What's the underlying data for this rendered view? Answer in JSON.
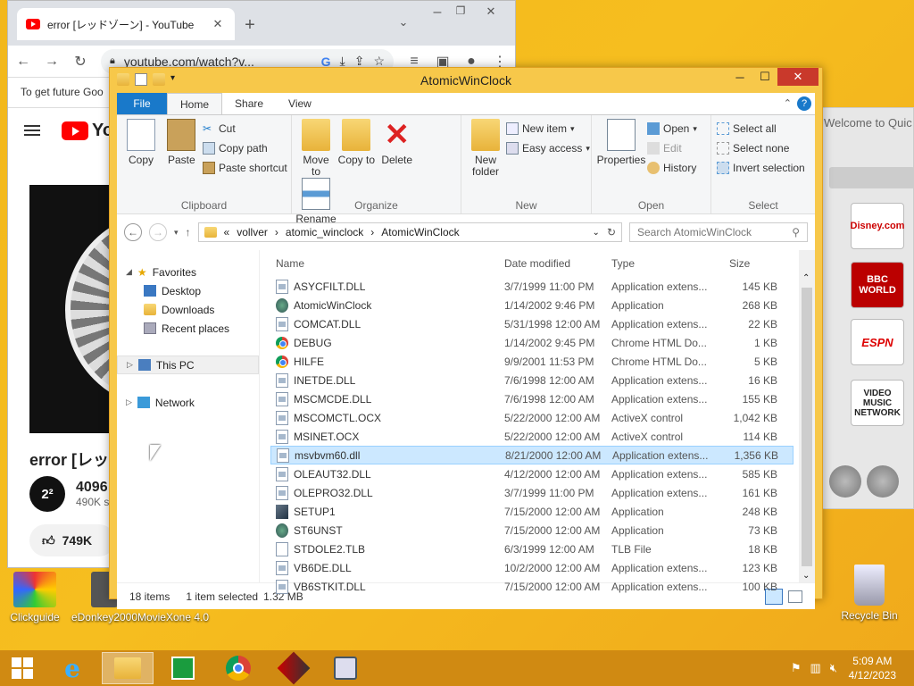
{
  "chrome": {
    "tab_title": "error [レッドゾーン] - YouTube",
    "url": "youtube.com/watch?v...",
    "signin_text": "To get future Goo",
    "yt_logo": "Yo",
    "video_title": "error [レッ",
    "channel_avatar": "2²",
    "channel_name": "4096",
    "channel_subs": "490K s",
    "likes": "749K"
  },
  "radio": {
    "header": "Welcome to Quic",
    "logos": [
      "Disney.com",
      "BBC WORLD",
      "ESPN",
      "VIDEO MUSIC NETWORK"
    ]
  },
  "desktop_icons": [
    {
      "label": "Clickguide"
    },
    {
      "label": "eDonkey2000"
    },
    {
      "label": "MovieXone 4.0"
    },
    {
      "label": "Recycle Bin"
    }
  ],
  "explorer": {
    "title": "AtomicWinClock",
    "tabs": {
      "file": "File",
      "home": "Home",
      "share": "Share",
      "view": "View"
    },
    "ribbon": {
      "copy": "Copy",
      "paste": "Paste",
      "cut": "Cut",
      "copy_path": "Copy path",
      "paste_shortcut": "Paste shortcut",
      "clipboard": "Clipboard",
      "move_to": "Move to",
      "copy_to": "Copy to",
      "delete": "Delete",
      "rename": "Rename",
      "organize": "Organize",
      "new_folder": "New folder",
      "new_item": "New item",
      "easy_access": "Easy access",
      "new": "New",
      "properties": "Properties",
      "open_btn": "Open",
      "edit": "Edit",
      "history": "History",
      "open": "Open",
      "select_all": "Select all",
      "select_none": "Select none",
      "invert_selection": "Invert selection",
      "select": "Select"
    },
    "breadcrumb": [
      "vollver",
      "atomic_winclock",
      "AtomicWinClock"
    ],
    "breadcrumb_prefix": "«",
    "search_placeholder": "Search AtomicWinClock",
    "nav": {
      "favorites": "Favorites",
      "desktop": "Desktop",
      "downloads": "Downloads",
      "recent": "Recent places",
      "this_pc": "This PC",
      "network": "Network"
    },
    "columns": {
      "name": "Name",
      "date": "Date modified",
      "type": "Type",
      "size": "Size"
    },
    "files": [
      {
        "name": "ASYCFILT.DLL",
        "date": "3/7/1999 11:00 PM",
        "type": "Application extens...",
        "size": "145 KB",
        "icon": "dll"
      },
      {
        "name": "AtomicWinClock",
        "date": "1/14/2002 9:46 PM",
        "type": "Application",
        "size": "268 KB",
        "icon": "app"
      },
      {
        "name": "COMCAT.DLL",
        "date": "5/31/1998 12:00 AM",
        "type": "Application extens...",
        "size": "22 KB",
        "icon": "dll"
      },
      {
        "name": "DEBUG",
        "date": "1/14/2002 9:45 PM",
        "type": "Chrome HTML Do...",
        "size": "1 KB",
        "icon": "chrome"
      },
      {
        "name": "HILFE",
        "date": "9/9/2001 11:53 PM",
        "type": "Chrome HTML Do...",
        "size": "5 KB",
        "icon": "chrome"
      },
      {
        "name": "INETDE.DLL",
        "date": "7/6/1998 12:00 AM",
        "type": "Application extens...",
        "size": "16 KB",
        "icon": "dll"
      },
      {
        "name": "MSCMCDE.DLL",
        "date": "7/6/1998 12:00 AM",
        "type": "Application extens...",
        "size": "155 KB",
        "icon": "dll"
      },
      {
        "name": "MSCOMCTL.OCX",
        "date": "5/22/2000 12:00 AM",
        "type": "ActiveX control",
        "size": "1,042 KB",
        "icon": "dll"
      },
      {
        "name": "MSINET.OCX",
        "date": "5/22/2000 12:00 AM",
        "type": "ActiveX control",
        "size": "114 KB",
        "icon": "dll"
      },
      {
        "name": "msvbvm60.dll",
        "date": "8/21/2000 12:00 AM",
        "type": "Application extens...",
        "size": "1,356 KB",
        "icon": "dll"
      },
      {
        "name": "OLEAUT32.DLL",
        "date": "4/12/2000 12:00 AM",
        "type": "Application extens...",
        "size": "585 KB",
        "icon": "dll"
      },
      {
        "name": "OLEPRO32.DLL",
        "date": "3/7/1999 11:00 PM",
        "type": "Application extens...",
        "size": "161 KB",
        "icon": "dll"
      },
      {
        "name": "SETUP1",
        "date": "7/15/2000 12:00 AM",
        "type": "Application",
        "size": "248 KB",
        "icon": "setup"
      },
      {
        "name": "ST6UNST",
        "date": "7/15/2000 12:00 AM",
        "type": "Application",
        "size": "73 KB",
        "icon": "app"
      },
      {
        "name": "STDOLE2.TLB",
        "date": "6/3/1999 12:00 AM",
        "type": "TLB File",
        "size": "18 KB",
        "icon": "file"
      },
      {
        "name": "VB6DE.DLL",
        "date": "10/2/2000 12:00 AM",
        "type": "Application extens...",
        "size": "123 KB",
        "icon": "dll"
      },
      {
        "name": "VB6STKIT.DLL",
        "date": "7/15/2000 12:00 AM",
        "type": "Application extens...",
        "size": "100 KB",
        "icon": "dll"
      }
    ],
    "selected_index": 9,
    "status_items": "18 items",
    "status_selected": "1 item selected",
    "status_size": "1.32 MB"
  },
  "taskbar": {
    "time": "5:09 AM",
    "date": "4/12/2023"
  },
  "colors": {
    "file_tab": "#1979ca",
    "selection": "#cce8ff",
    "taskbar": "#d08a12",
    "window_frame": "#f7c84a"
  }
}
